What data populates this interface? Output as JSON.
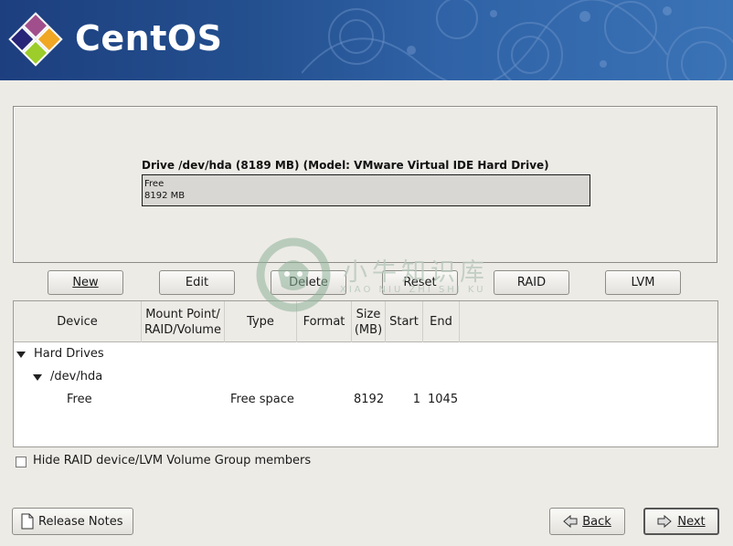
{
  "brand": {
    "name": "CentOS"
  },
  "drive": {
    "title": "Drive /dev/hda (8189 MB) (Model: VMware Virtual IDE Hard Drive)",
    "segment_label": "Free",
    "segment_size": "8192 MB"
  },
  "toolbar": {
    "new": "New",
    "edit": "Edit",
    "delete": "Delete",
    "reset": "Reset",
    "raid": "RAID",
    "lvm": "LVM"
  },
  "table": {
    "headers": {
      "device": "Device",
      "mount_line1": "Mount Point/",
      "mount_line2": "RAID/Volume",
      "type": "Type",
      "format": "Format",
      "size_line1": "Size",
      "size_line2": "(MB)",
      "start": "Start",
      "end": "End"
    },
    "rows": [
      {
        "device": "Hard Drives"
      },
      {
        "device": "/dev/hda"
      },
      {
        "device": "Free",
        "type": "Free space",
        "size": "8192",
        "start": "1",
        "end": "1045"
      }
    ]
  },
  "options": {
    "hide_raid_label": "Hide RAID device/LVM Volume Group members"
  },
  "footer": {
    "release_notes": "Release Notes",
    "back": "Back",
    "next": "Next"
  },
  "watermark": {
    "cn": "小牛知识库",
    "en": "XIAO NIU ZHI SHI KU"
  },
  "colors": {
    "banner": "#24508f",
    "background": "#edebe6",
    "watermark": "#8fb39a"
  }
}
